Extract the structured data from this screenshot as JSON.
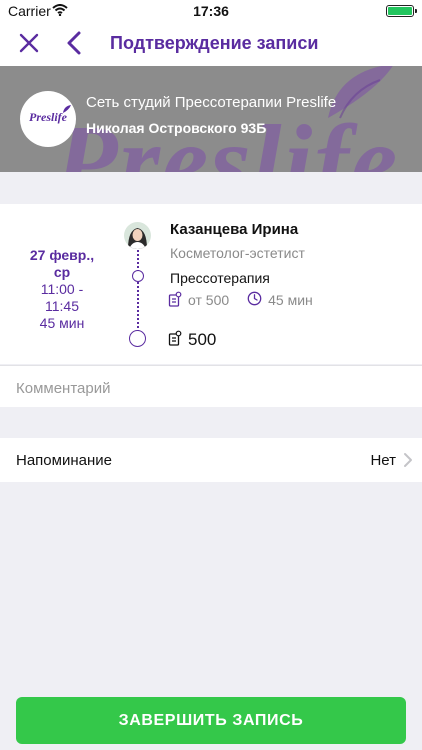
{
  "status_bar": {
    "carrier": "Carrier",
    "time": "17:36",
    "battery_level_fraction": 1.0
  },
  "nav": {
    "title": "Подтверждение записи",
    "close_icon": "close-icon",
    "back_icon": "chevron-left-icon"
  },
  "salon": {
    "logo_text": "Preslife",
    "name": "Сеть студий Прессотерапии Preslife",
    "address": "Николая Островского 93Б",
    "banner_wordmark": "Preslife"
  },
  "appointment": {
    "date": "27 февр.,",
    "weekday": "ср",
    "time_from": "11:00 -",
    "time_to": "11:45",
    "duration": "45 мин",
    "master_name": "Казанцева Ирина",
    "master_role": "Косметолог-эстетист",
    "service": "Прессотерапия",
    "price": "от 500",
    "service_duration": "45 мин",
    "total": "500"
  },
  "comment": {
    "placeholder": "Комментарий",
    "value": ""
  },
  "reminder": {
    "label": "Напоминание",
    "value": "Нет"
  },
  "actions": {
    "finish_label": "ЗАВЕРШИТЬ ЗАПИСЬ"
  },
  "colors": {
    "accent": "#5a2ca0",
    "button": "#34c84a",
    "background": "#efeff4",
    "muted_text": "#8a8a8a"
  }
}
